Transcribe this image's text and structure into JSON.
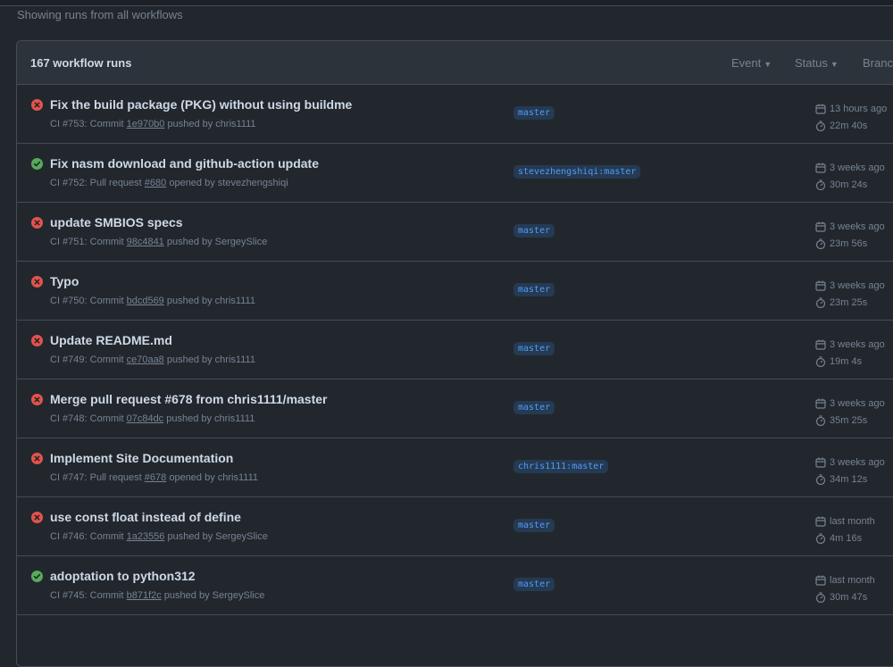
{
  "subtitle": "Showing runs from all workflows",
  "header": {
    "count_label": "167 workflow runs",
    "filters": [
      "Event",
      "Status",
      "Branc"
    ]
  },
  "colors": {
    "failure": "#e5534b",
    "success": "#57ab5a"
  },
  "runs": [
    {
      "status": "failure",
      "title": "Fix the build package (PKG) without using buildme",
      "meta_prefix": "CI #753: Commit ",
      "ref": "1e970b0",
      "meta_suffix": " pushed by chris1111",
      "branch": "master",
      "time": "13 hours ago",
      "duration": "22m 40s"
    },
    {
      "status": "success",
      "title": "Fix nasm download and github-action update",
      "meta_prefix": "CI #752: Pull request ",
      "ref": "#680",
      "meta_suffix": " opened by stevezhengshiqi",
      "branch": "stevezhengshiqi:master",
      "time": "3 weeks ago",
      "duration": "30m 24s"
    },
    {
      "status": "failure",
      "title": "update SMBIOS specs",
      "meta_prefix": "CI #751: Commit ",
      "ref": "98c4841",
      "meta_suffix": " pushed by SergeySlice",
      "branch": "master",
      "time": "3 weeks ago",
      "duration": "23m 56s"
    },
    {
      "status": "failure",
      "title": "Typo",
      "meta_prefix": "CI #750: Commit ",
      "ref": "bdcd569",
      "meta_suffix": " pushed by chris1111",
      "branch": "master",
      "time": "3 weeks ago",
      "duration": "23m 25s"
    },
    {
      "status": "failure",
      "title": "Update README.md",
      "meta_prefix": "CI #749: Commit ",
      "ref": "ce70aa8",
      "meta_suffix": " pushed by chris1111",
      "branch": "master",
      "time": "3 weeks ago",
      "duration": "19m 4s"
    },
    {
      "status": "failure",
      "title": "Merge pull request #678 from chris1111/master",
      "meta_prefix": "CI #748: Commit ",
      "ref": "07c84dc",
      "meta_suffix": " pushed by chris1111",
      "branch": "master",
      "time": "3 weeks ago",
      "duration": "35m 25s"
    },
    {
      "status": "failure",
      "title": "Implement Site Documentation",
      "meta_prefix": "CI #747: Pull request ",
      "ref": "#678",
      "meta_suffix": " opened by chris1111",
      "branch": "chris1111:master",
      "time": "3 weeks ago",
      "duration": "34m 12s"
    },
    {
      "status": "failure",
      "title": "use const float instead of define",
      "meta_prefix": "CI #746: Commit ",
      "ref": "1a23556",
      "meta_suffix": " pushed by SergeySlice",
      "branch": "master",
      "time": "last month",
      "duration": "4m 16s"
    },
    {
      "status": "success",
      "title": "adoptation to python312",
      "meta_prefix": "CI #745: Commit ",
      "ref": "b871f2c",
      "meta_suffix": " pushed by SergeySlice",
      "branch": "master",
      "time": "last month",
      "duration": "30m 47s"
    }
  ]
}
